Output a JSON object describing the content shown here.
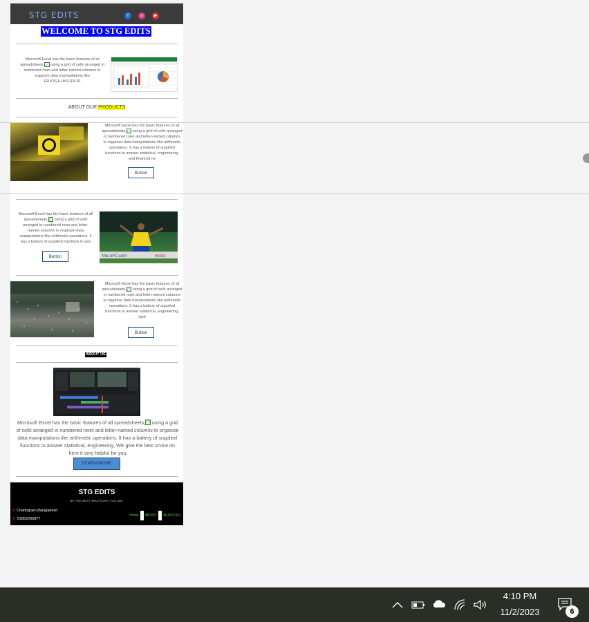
{
  "site": {
    "logo": "STG EDITS",
    "social": [
      "facebook-icon",
      "instagram-icon",
      "youtube-icon"
    ],
    "welcome": "WELCOME TO STG EDITS"
  },
  "intro": {
    "line1": "Microsoft Excel has the basic features of all",
    "line2a": "spreadsheets,",
    "footnote": "[7]",
    "line2b": " using a grid of ",
    "cells": "cells",
    "line2c": " arranged in",
    "line3a": "numbered ",
    "rows": "rows",
    "line3b": " and letter-named ",
    "columns": "columns",
    "line3c": " to",
    "line4": "organize data manipulations like",
    "line5": "ERJOSJLUKSJFKJD"
  },
  "about_products": {
    "prefix": "ABOUT OUR ",
    "highlight": "PRODUCTS"
  },
  "products": [
    {
      "text_l1": "Microsoft Excel has the basic features of all",
      "text_l2a": "spreadsheets,",
      "footnote": "[7]",
      "text_l2b": " using a grid of ",
      "cells": "cells",
      "text_l2c": " arranged",
      "text_l3a": "in numbered ",
      "rows": "rows",
      "text_l3b": " and letter-named ",
      "columns": "columns",
      "text_l4": "to organize data manipulations like arithmetic",
      "text_l5": "operations. It has a battery of supplied",
      "text_l6": "functions to answer statistical, engineering,",
      "text_l7": "and financial ne",
      "button": "Button"
    },
    {
      "text_l1": "Microsoft Excel has the basic features of all",
      "text_l2a": "spreadsheets,",
      "footnote": "[7]",
      "text_l2b": " using a grid of ",
      "cells": "cells",
      "text_l3a": "arranged in numbered ",
      "rows": "rows",
      "text_l3b": " and letter-",
      "text_l4a": "named ",
      "columns": "columns",
      "text_l4b": " to organize data",
      "text_l5": "manipulations like arithmetic operations. It",
      "text_l6": "has a battery of supplied functions to ans",
      "button": "Button"
    },
    {
      "text_l1": "Microsoft Excel has the basic features of all",
      "text_l2a": "spreadsheets,",
      "footnote": "[7]",
      "text_l2b": " using a grid of ",
      "cells": "cells",
      "text_l2c": " arranged",
      "text_l3a": "in numbered ",
      "rows": "rows",
      "text_l3b": " and letter-named ",
      "columns": "columns",
      "text_l4": "to organize data manipulations like arithmetic",
      "text_l5": "operations. It has a battery of supplied",
      "text_l6": "functions to answer statistical, engineering,",
      "text_l7": "hjsd",
      "button": "Button"
    }
  ],
  "about_us": {
    "heading": "ABOUT US",
    "p1": "Microsoft Excel has the basic features of all spreadsheets,",
    "footnote": "[7]",
    "p2": " using a grid",
    "p3a": "of ",
    "cells": "cells",
    "p3b": " arranged in numbered ",
    "rows": "rows",
    "p3c": " and letter-named ",
    "columns": "columns",
    "p3d": " to organize",
    "p4": "data manipulations like arithmetic operations. It has a battery of supplied",
    "p5": "functions to answer statistical, engineering, WE give the best srvice on",
    "p6": "here it very helpful for you",
    "button": "LEARN MORE"
  },
  "footer": {
    "title": "STG EDITS",
    "subtitle": "BE THE BEST WHATOVER YOU ARE",
    "location": "Chattogram,Bangladesh",
    "phone": "01862005877",
    "links": [
      "Home",
      "ABOUT",
      "SERVICES"
    ]
  },
  "taskbar": {
    "time": "4:10 PM",
    "date": "11/2/2023",
    "notifications": "6",
    "icons": [
      "chevron-up-icon",
      "battery-icon",
      "onedrive-cloud-icon",
      "wifi-icon",
      "volume-icon",
      "notification-icon"
    ]
  },
  "colors": {
    "welcome_bg": "#0000ff",
    "highlight": "#ffff00",
    "button_border": "#1e4f87",
    "learn_more_bg": "#4a8ed0",
    "footer_link": "#3ad33a"
  }
}
